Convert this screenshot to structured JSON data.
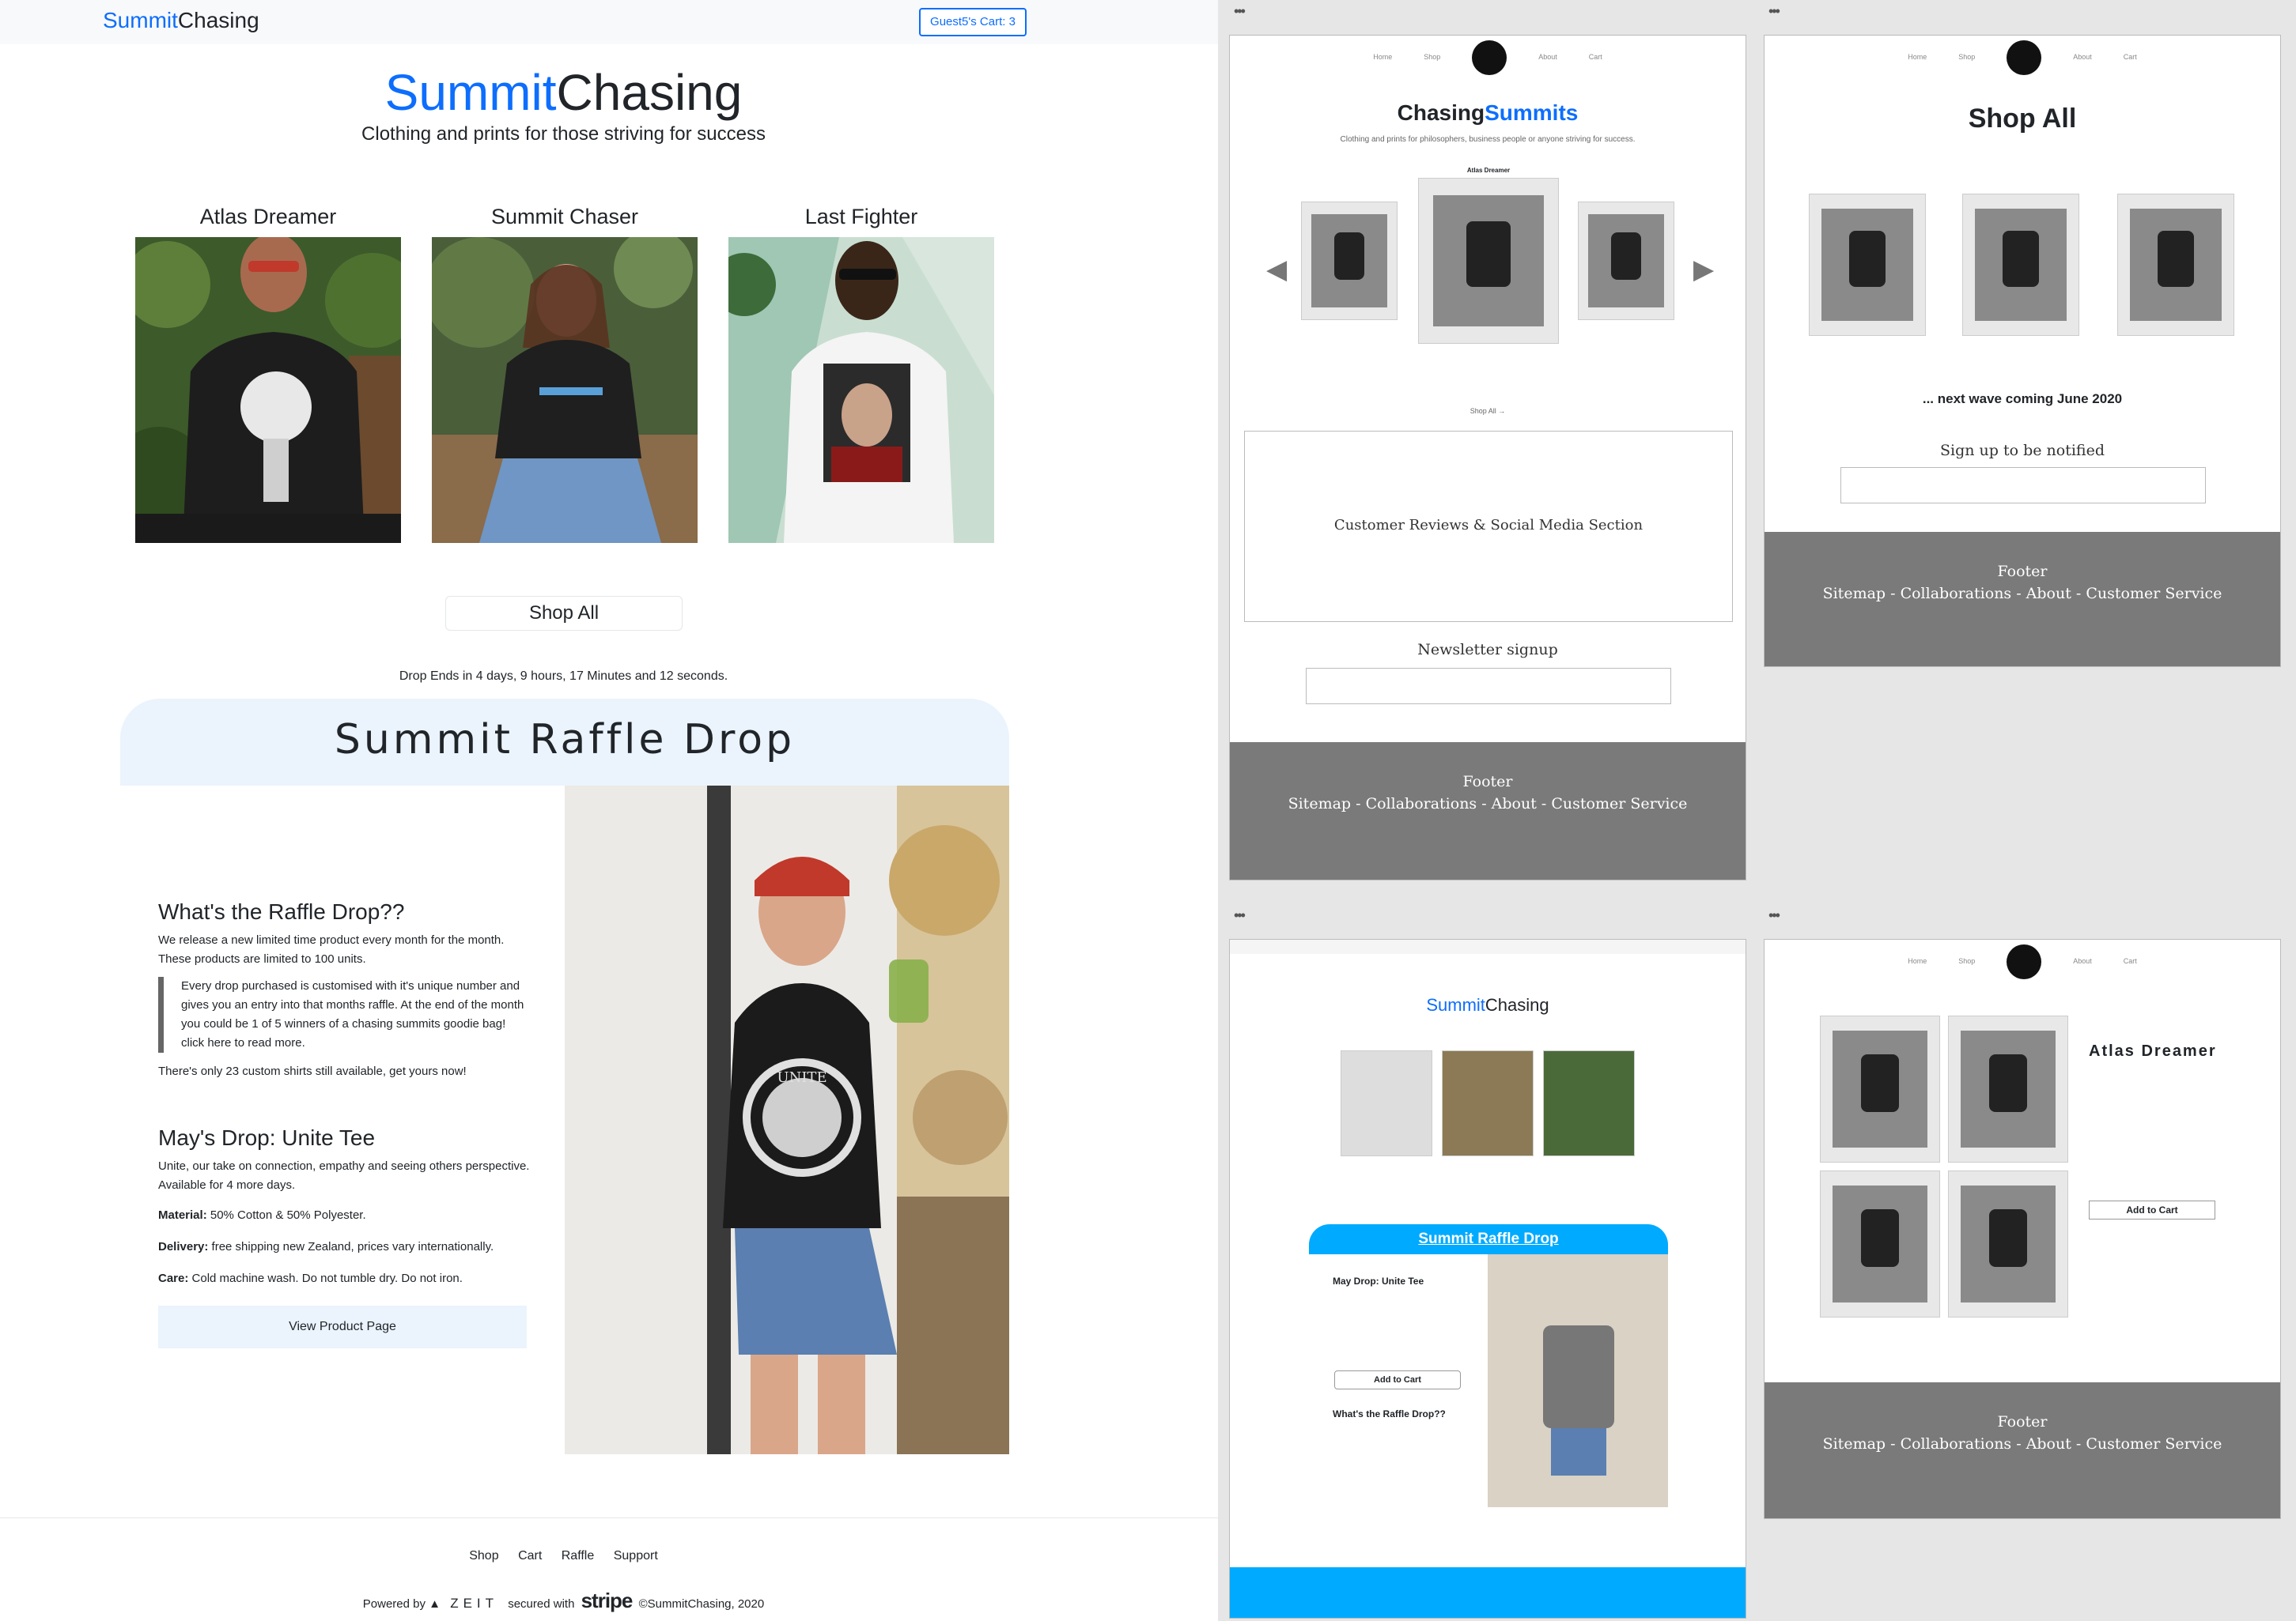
{
  "navbar": {
    "brand_part1": "Summit",
    "brand_part2": "Chasing",
    "cart_label": "Guest5's Cart: 3"
  },
  "hero": {
    "title_part1": "Summit",
    "title_part2": "Chasing",
    "subtitle": "Clothing and prints for those striving for success"
  },
  "products": [
    {
      "name": "Atlas Dreamer"
    },
    {
      "name": "Summit Chaser"
    },
    {
      "name": "Last Fighter"
    }
  ],
  "shop_all_label": "Shop All",
  "countdown": "Drop Ends in 4 days, 9 hours, 17 Minutes and 12 seconds.",
  "raffle": {
    "title": "Summit Raffle Drop",
    "what_heading": "What's the Raffle Drop??",
    "what_text": "We release a new limited time product every month for the month. These products are limited to 100 units.",
    "quote": "Every drop purchased is customised with it's unique number and gives you an entry into that months raffle. At the end of the month you could be 1 of 5 winners of a chasing summits goodie bag! click here to read more.",
    "stock_text": "There's only 23 custom shirts still available, get yours now!",
    "drop_heading": "May's Drop: Unite Tee",
    "drop_text": "Unite, our take on connection, empathy and seeing others perspective. Available for 4 more days.",
    "material_label": "Material:",
    "material_value": "50% Cotton & 50% Polyester.",
    "delivery_label": "Delivery:",
    "delivery_value": "free shipping new Zealand, prices vary internationally.",
    "care_label": "Care:",
    "care_value": "Cold machine wash. Do not tumble dry. Do not iron.",
    "view_button": "View Product Page",
    "shirt_text": "UNITE"
  },
  "footer": {
    "links": [
      "Shop",
      "Cart",
      "Raffle",
      "Support"
    ],
    "powered_by": "Powered by",
    "zeit": "ZEIT",
    "secured_with": "secured with",
    "stripe": "stripe",
    "copyright": "©SummitChasing, 2020"
  },
  "wireframes": {
    "nav_items": [
      "Home",
      "Shop",
      "About",
      "Cart"
    ],
    "home": {
      "title_part1": "Chasing",
      "title_part2": "Summits",
      "subtitle": "Clothing and prints for philosophers, business people or anyone striving for success.",
      "featured_label": "Atlas Dreamer",
      "shop_all": "Shop All →",
      "reviews": "Customer Reviews & Social Media Section",
      "newsletter": "Newsletter signup"
    },
    "shop": {
      "title": "Shop All",
      "coming": "... next wave coming June 2020",
      "signup": "Sign up to be notified"
    },
    "footer": {
      "title": "Footer",
      "links": "Sitemap - Collaborations - About - Customer Service"
    },
    "mobile": {
      "brand_part1": "Summit",
      "brand_part2": "Chasing",
      "raffle_title": "Summit Raffle Drop",
      "drop_heading": "May Drop: Unite Tee",
      "add_to_cart": "Add to Cart",
      "what_heading": "What's the Raffle Drop??"
    },
    "product": {
      "title": "Atlas Dreamer",
      "add_to_cart": "Add to Cart"
    }
  },
  "colors": {
    "brand_blue": "#0d6efd",
    "raffle_bg": "#ebf4fd",
    "wire_footer": "#7a7a7a",
    "mobile_accent": "#00aaff"
  }
}
